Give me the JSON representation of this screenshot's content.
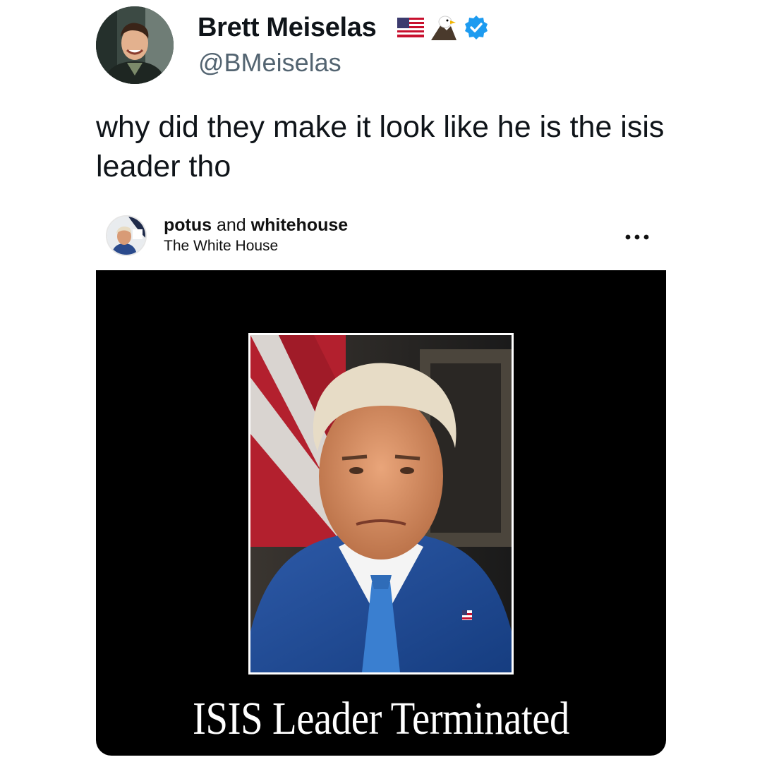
{
  "tweet": {
    "author": {
      "display_name": "Brett Meiselas",
      "handle": "@BMeiselas",
      "avatar_icon": "profile-photo",
      "name_emojis": [
        "us-flag-icon",
        "eagle-icon"
      ],
      "verified": true,
      "verified_color": "#1d9bf0"
    },
    "text": "why did they make it look like he is the isis leader tho"
  },
  "embedded_post": {
    "account_names": "potus and whitehouse",
    "account_first": "potus",
    "account_joiner": " and ",
    "account_second": "whitehouse",
    "subtitle": "The White House",
    "more_icon": "more-horizontal-icon",
    "media": {
      "background": "#000000",
      "caption": "ISIS Leader Terminated"
    }
  }
}
